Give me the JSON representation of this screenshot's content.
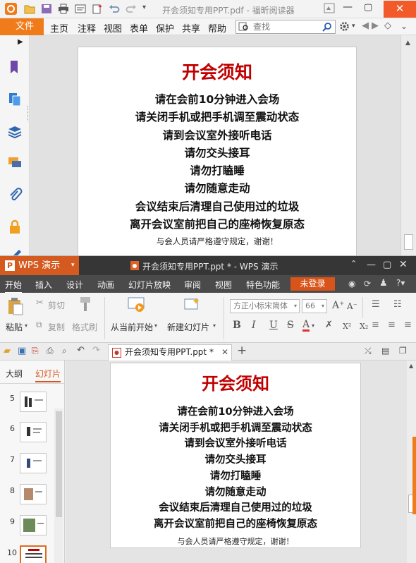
{
  "foxit": {
    "title": "开会须知专用PPT.pdf - 福昕阅读器",
    "menu": {
      "file": "文件",
      "items": [
        "主页",
        "注释",
        "视图",
        "表单",
        "保护",
        "共享",
        "帮助"
      ]
    },
    "search": {
      "placeholder": "查找",
      "value": ""
    }
  },
  "slide": {
    "title": "开会须知",
    "lines": [
      "请在会前10分钟进入会场",
      "请关闭手机或把手机调至震动状态",
      "请到会议室外接听电话",
      "请勿交头接耳",
      "请勿打瞌睡",
      "请勿随意走动",
      "会议结束后清理自己使用过的垃圾",
      "离开会议室前把自己的座椅恢复原态"
    ],
    "footer": "与会人员请严格遵守规定，谢谢！"
  },
  "wps": {
    "brand": "WPS 演示",
    "title": "开会须知专用PPT.ppt * - WPS 演示",
    "tabs": [
      "开始",
      "插入",
      "设计",
      "动画",
      "幻灯片放映",
      "审阅",
      "视图",
      "特色功能"
    ],
    "login": "未登录",
    "ribbon": {
      "paste": "粘贴",
      "cut": "剪切",
      "copy": "复制",
      "format_painter": "格式刷",
      "from_current": "从当前开始",
      "new_slide": "新建幻灯片",
      "font_name": "方正小标宋简体",
      "font_size": "66",
      "bold": "B",
      "italic": "I",
      "underline": "U",
      "strike": "S",
      "font_color": "A",
      "superscript": "X²",
      "subscript": "X₂"
    },
    "doc_tab": "开会须知专用PPT.ppt *",
    "panel_tabs": {
      "outline": "大纲",
      "slides": "幻灯片"
    },
    "thumbnails": [
      "5",
      "6",
      "7",
      "8",
      "9",
      "10"
    ]
  },
  "colors": {
    "accent_orange": "#f07b1b",
    "slide_title_red": "#c00000",
    "wps_orange": "#d45a1f"
  }
}
